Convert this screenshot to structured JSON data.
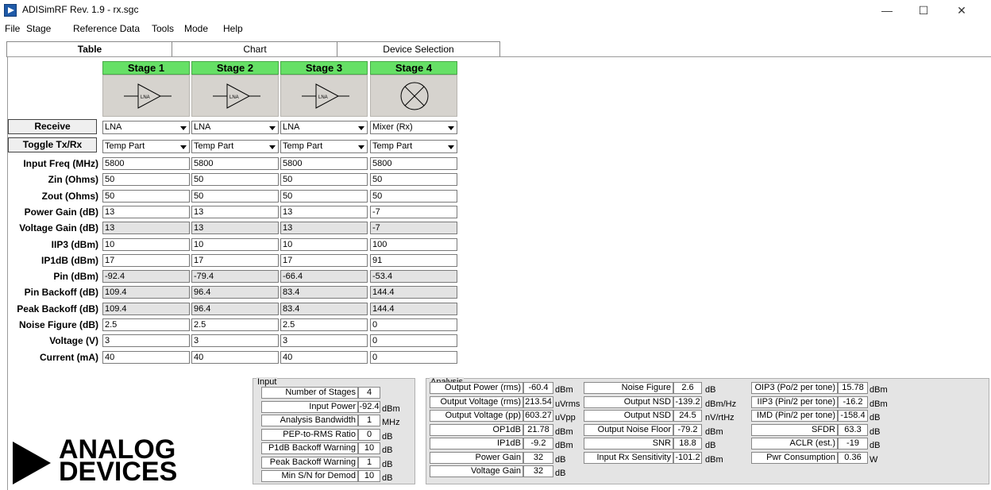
{
  "app": {
    "title": "ADISimRF Rev. 1.9 - rx.sgc"
  },
  "window_controls": {
    "minimize": "—",
    "maximize": "☐",
    "close": "✕"
  },
  "menu": [
    "File",
    "Stage",
    "Reference Data",
    "Tools",
    "Mode",
    "Help"
  ],
  "tabs": [
    "Table",
    "Chart",
    "Device Selection"
  ],
  "stages": [
    {
      "header": "Stage 1",
      "symbol": "amp-lna-icon",
      "type": "LNA",
      "part": "Temp Part"
    },
    {
      "header": "Stage 2",
      "symbol": "amp-lna-icon",
      "type": "LNA",
      "part": "Temp Part"
    },
    {
      "header": "Stage 3",
      "symbol": "amp-lna-icon",
      "type": "LNA",
      "part": "Temp Part"
    },
    {
      "header": "Stage 4",
      "symbol": "mixer-icon",
      "type": "Mixer (Rx)",
      "part": "Temp Part"
    }
  ],
  "symbol_label": "LNA",
  "buttons": {
    "receive": "Receive",
    "toggle": "Toggle Tx/Rx"
  },
  "rows": [
    {
      "label": "Input Freq (MHz)",
      "values": [
        "5800",
        "5800",
        "5800",
        "5800"
      ],
      "gray": false
    },
    {
      "label": "Zin (Ohms)",
      "values": [
        "50",
        "50",
        "50",
        "50"
      ],
      "gray": false
    },
    {
      "label": "Zout (Ohms)",
      "values": [
        "50",
        "50",
        "50",
        "50"
      ],
      "gray": false
    },
    {
      "label": "Power Gain (dB)",
      "values": [
        "13",
        "13",
        "13",
        "-7"
      ],
      "gray": false
    },
    {
      "label": "Voltage Gain (dB)",
      "values": [
        "13",
        "13",
        "13",
        "-7"
      ],
      "gray": true
    },
    {
      "label": "IIP3 (dBm)",
      "values": [
        "10",
        "10",
        "10",
        "100"
      ],
      "gray": false
    },
    {
      "label": "IP1dB (dBm)",
      "values": [
        "17",
        "17",
        "17",
        "91"
      ],
      "gray": false
    },
    {
      "label": "Pin (dBm)",
      "values": [
        "-92.4",
        "-79.4",
        "-66.4",
        "-53.4"
      ],
      "gray": true
    },
    {
      "label": "Pin Backoff (dB)",
      "values": [
        "109.4",
        "96.4",
        "83.4",
        "144.4"
      ],
      "gray": true
    },
    {
      "label": "Peak Backoff (dB)",
      "values": [
        "109.4",
        "96.4",
        "83.4",
        "144.4"
      ],
      "gray": true
    },
    {
      "label": "Noise Figure (dB)",
      "values": [
        "2.5",
        "2.5",
        "2.5",
        "0"
      ],
      "gray": false
    },
    {
      "label": "Voltage (V)",
      "values": [
        "3",
        "3",
        "3",
        "0"
      ],
      "gray": false
    },
    {
      "label": "Current (mA)",
      "values": [
        "40",
        "40",
        "40",
        "0"
      ],
      "gray": false
    }
  ],
  "input_panel": {
    "title": "Input",
    "items": [
      {
        "label": "Number of Stages",
        "value": "4",
        "unit": ""
      },
      {
        "label": "Input Power",
        "value": "-92.4",
        "unit": "dBm"
      },
      {
        "label": "Analysis Bandwidth",
        "value": "1",
        "unit": "MHz"
      },
      {
        "label": "PEP-to-RMS Ratio",
        "value": "0",
        "unit": "dB"
      },
      {
        "label": "P1dB Backoff Warning",
        "value": "10",
        "unit": "dB"
      },
      {
        "label": "Peak Backoff Warning",
        "value": "1",
        "unit": "dB"
      },
      {
        "label": "Min S/N for Demod",
        "value": "10",
        "unit": "dB"
      }
    ]
  },
  "analysis_panel": {
    "title": "Analysis",
    "col1": [
      {
        "label": "Output Power (rms)",
        "value": "-60.4",
        "unit": "dBm"
      },
      {
        "label": "Output Voltage (rms)",
        "value": "213.54",
        "unit": "uVrms"
      },
      {
        "label": "Output Voltage (pp)",
        "value": "603.27",
        "unit": "uVpp"
      },
      {
        "label": "OP1dB",
        "value": "21.78",
        "unit": "dBm"
      },
      {
        "label": "IP1dB",
        "value": "-9.2",
        "unit": "dBm"
      },
      {
        "label": "Power Gain",
        "value": "32",
        "unit": "dB"
      },
      {
        "label": "Voltage Gain",
        "value": "32",
        "unit": "dB"
      }
    ],
    "col2": [
      {
        "label": "Noise Figure",
        "value": "2.6",
        "unit": "dB"
      },
      {
        "label": "Output NSD",
        "value": "-139.2",
        "unit": "dBm/Hz"
      },
      {
        "label": "Output NSD",
        "value": "24.5",
        "unit": "nV/rtHz"
      },
      {
        "label": "Output Noise Floor",
        "value": "-79.2",
        "unit": "dBm"
      },
      {
        "label": "SNR",
        "value": "18.8",
        "unit": "dB"
      },
      {
        "label": "Input Rx Sensitivity",
        "value": "-101.2",
        "unit": "dBm"
      }
    ],
    "col3": [
      {
        "label": "OIP3 (Po/2 per tone)",
        "value": "15.78",
        "unit": "dBm"
      },
      {
        "label": "IIP3 (Pin/2 per tone)",
        "value": "-16.2",
        "unit": "dBm"
      },
      {
        "label": "IMD (Pin/2 per tone)",
        "value": "-158.4",
        "unit": "dB"
      },
      {
        "label": "SFDR",
        "value": "63.3",
        "unit": "dB"
      },
      {
        "label": "ACLR (est.)",
        "value": "-19",
        "unit": "dB"
      },
      {
        "label": "Pwr Consumption",
        "value": "0.36",
        "unit": "W"
      }
    ]
  },
  "logo": {
    "line1": "ANALOG",
    "line2": "DEVICES"
  }
}
